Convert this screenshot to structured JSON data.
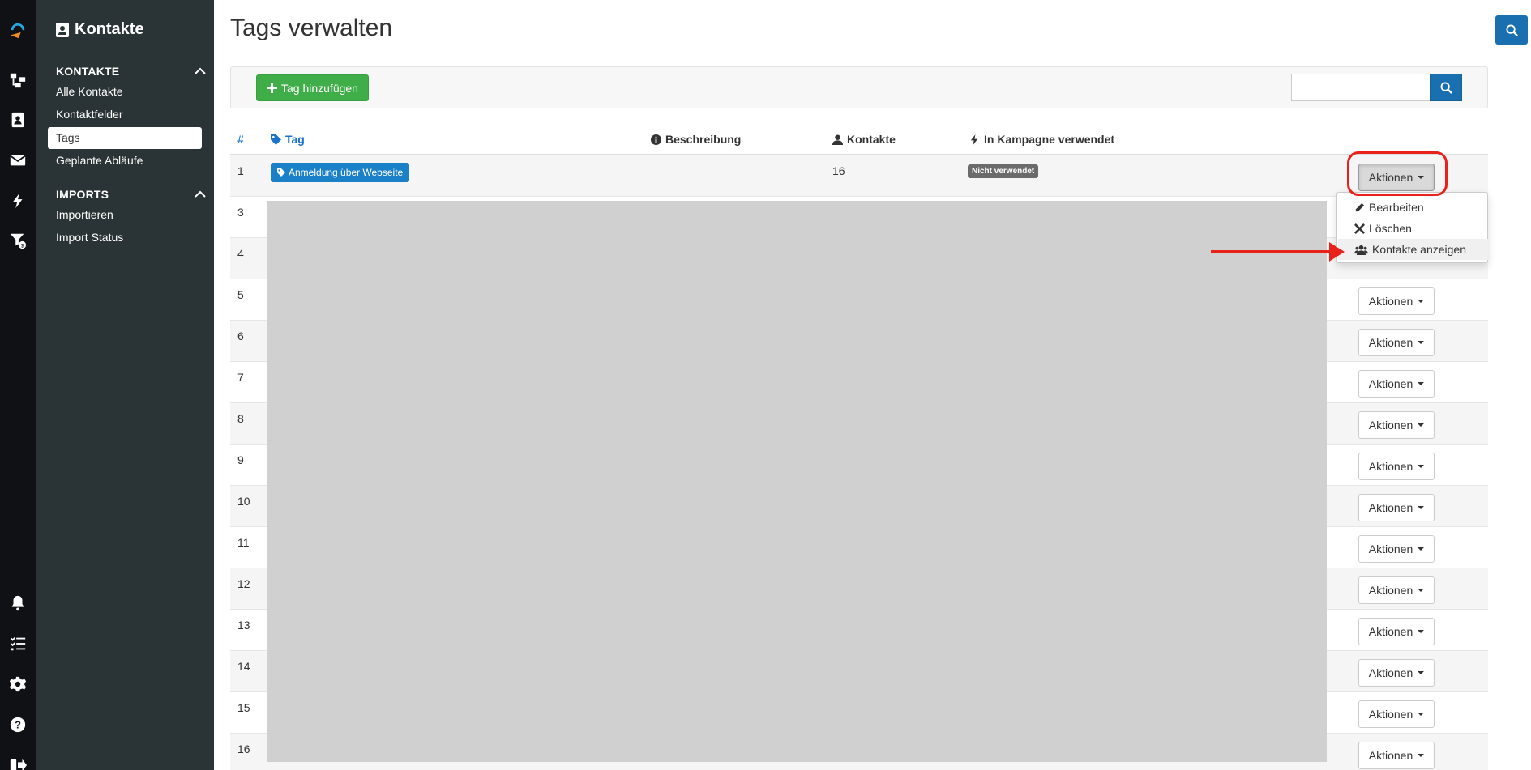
{
  "sidebar": {
    "title": "Kontakte",
    "sections": [
      {
        "label": "KONTAKTE",
        "items": [
          "Alle Kontakte",
          "Kontaktfelder",
          "Tags",
          "Geplante Abläufe"
        ]
      },
      {
        "label": "IMPORTS",
        "items": [
          "Importieren",
          "Import Status"
        ]
      }
    ],
    "active_item": "Tags"
  },
  "page": {
    "title": "Tags verwalten"
  },
  "toolbar": {
    "add_label": "Tag hinzufügen",
    "search_value": ""
  },
  "table": {
    "columns": {
      "num": "#",
      "tag": "Tag",
      "description": "Beschreibung",
      "contacts": "Kontakte",
      "campaign": "In Kampagne verwendet"
    },
    "first_row": {
      "num": "1",
      "tag": "Anmeldung über Webseite",
      "contacts": "16",
      "status": "Nicht verwendet"
    },
    "row_numbers": [
      "3",
      "4",
      "5",
      "6",
      "7",
      "8",
      "9",
      "10",
      "11",
      "12",
      "13",
      "14",
      "15",
      "16"
    ],
    "actions_label": "Aktionen"
  },
  "dropdown": {
    "items": [
      "Bearbeiten",
      "Löschen",
      "Kontakte anzeigen"
    ]
  },
  "colors": {
    "accent_blue": "#1a6fb0",
    "add_green": "#3fae49",
    "annotation_red": "#e8221b",
    "sidebar_bg": "#2a3336",
    "rail_bg": "#0f1115"
  }
}
